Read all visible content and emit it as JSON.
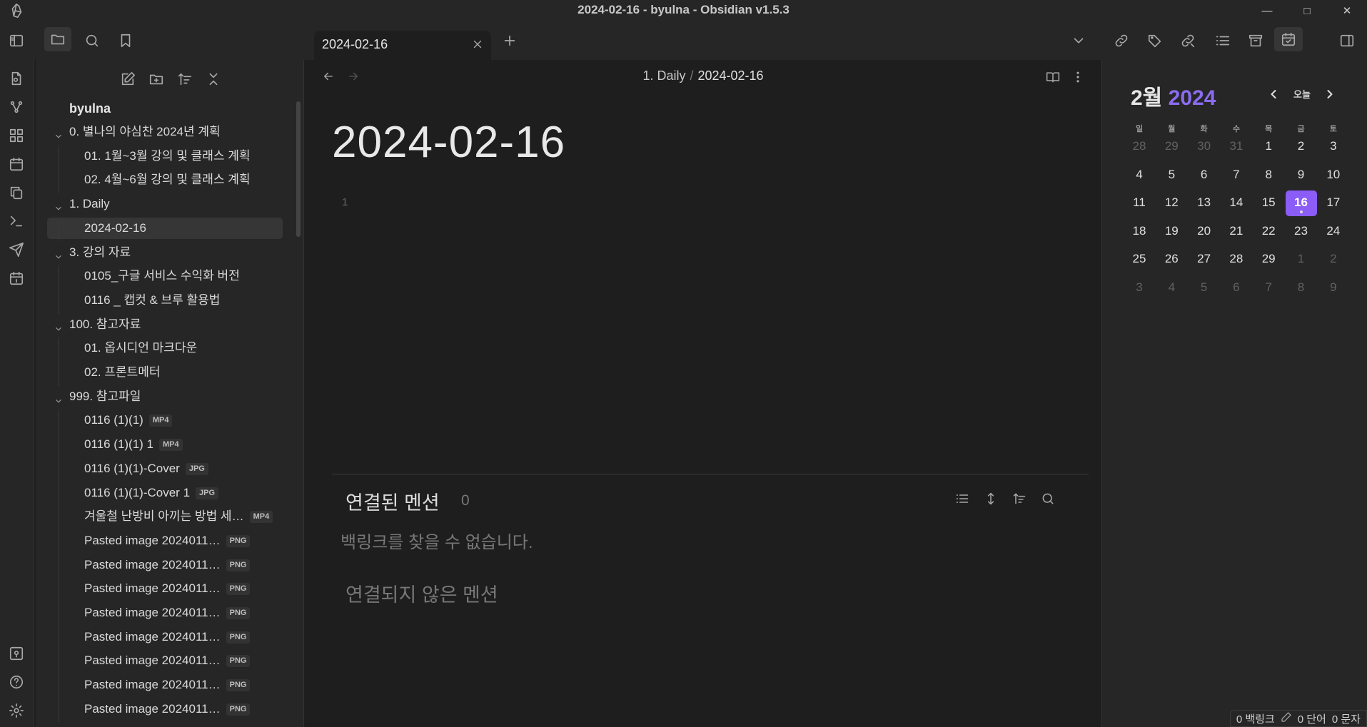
{
  "window": {
    "title": "2024-02-16 - byulna - Obsidian v1.5.3",
    "controls": [
      "minimize-icon",
      "maximize-icon",
      "close-icon"
    ]
  },
  "tab": {
    "title": "2024-02-16"
  },
  "sidebar": {
    "vault_name": "byulna",
    "tree": [
      {
        "label": "0. 별나의 야심찬 2024년 계획",
        "level": 0,
        "folder": true
      },
      {
        "label": "01. 1월~3월 강의 및 클래스 계획",
        "level": 1
      },
      {
        "label": "02. 4월~6월 강의 및 클래스 계획",
        "level": 1
      },
      {
        "label": "1. Daily",
        "level": 0,
        "folder": true
      },
      {
        "label": "2024-02-16",
        "level": 1,
        "active": true
      },
      {
        "label": "3. 강의 자료",
        "level": 0,
        "folder": true
      },
      {
        "label": "0105_구글 서비스 수익화 버전",
        "level": 1
      },
      {
        "label": "0116 _ 캡컷 & 브루 활용법",
        "level": 1
      },
      {
        "label": "100. 참고자료",
        "level": 0,
        "folder": true
      },
      {
        "label": "01. 옵시디언 마크다운",
        "level": 1
      },
      {
        "label": "02. 프론트메터",
        "level": 1
      },
      {
        "label": "999. 참고파일",
        "level": 0,
        "folder": true
      },
      {
        "label": "0116 (1)(1)",
        "level": 1,
        "badge": "MP4"
      },
      {
        "label": "0116 (1)(1) 1",
        "level": 1,
        "badge": "MP4"
      },
      {
        "label": "0116 (1)(1)-Cover",
        "level": 1,
        "badge": "JPG"
      },
      {
        "label": "0116 (1)(1)-Cover 1",
        "level": 1,
        "badge": "JPG"
      },
      {
        "label": "겨울철 난방비 아끼는 방법 세…",
        "level": 1,
        "badge": "MP4"
      },
      {
        "label": "Pasted image 2024011…",
        "level": 1,
        "badge": "PNG"
      },
      {
        "label": "Pasted image 2024011…",
        "level": 1,
        "badge": "PNG"
      },
      {
        "label": "Pasted image 2024011…",
        "level": 1,
        "badge": "PNG"
      },
      {
        "label": "Pasted image 2024011…",
        "level": 1,
        "badge": "PNG"
      },
      {
        "label": "Pasted image 2024011…",
        "level": 1,
        "badge": "PNG"
      },
      {
        "label": "Pasted image 2024011…",
        "level": 1,
        "badge": "PNG"
      },
      {
        "label": "Pasted image 2024011…",
        "level": 1,
        "badge": "PNG"
      },
      {
        "label": "Pasted image 2024011…",
        "level": 1,
        "badge": "PNG"
      }
    ]
  },
  "editor": {
    "breadcrumb_folder": "1. Daily",
    "breadcrumb_sep": "/",
    "breadcrumb_file": "2024-02-16",
    "title": "2024-02-16",
    "line_number": "1",
    "linked_mentions_label": "연결된 멘션",
    "linked_mentions_count": "0",
    "no_backlinks": "백링크를 찾을 수 없습니다.",
    "unlinked_mentions_label": "연결되지 않은 멘션"
  },
  "calendar": {
    "month": "2월",
    "year": "2024",
    "today_label": "오늘",
    "weekdays": [
      "월",
      "화",
      "수",
      "목",
      "금",
      "토",
      "일"
    ],
    "weekdays_display": [
      "일",
      "월",
      "화",
      "수",
      "목",
      "금",
      "토"
    ],
    "weeks": [
      [
        {
          "d": "28",
          "dim": true
        },
        {
          "d": "29",
          "dim": true
        },
        {
          "d": "30",
          "dim": true
        },
        {
          "d": "31",
          "dim": true
        },
        {
          "d": "1"
        },
        {
          "d": "2"
        },
        {
          "d": "3"
        }
      ],
      [
        {
          "d": "4"
        },
        {
          "d": "5"
        },
        {
          "d": "6"
        },
        {
          "d": "7"
        },
        {
          "d": "8"
        },
        {
          "d": "9"
        },
        {
          "d": "10"
        }
      ],
      [
        {
          "d": "11"
        },
        {
          "d": "12"
        },
        {
          "d": "13"
        },
        {
          "d": "14"
        },
        {
          "d": "15"
        },
        {
          "d": "16",
          "today": true
        },
        {
          "d": "17"
        }
      ],
      [
        {
          "d": "18"
        },
        {
          "d": "19"
        },
        {
          "d": "20"
        },
        {
          "d": "21"
        },
        {
          "d": "22"
        },
        {
          "d": "23"
        },
        {
          "d": "24"
        }
      ],
      [
        {
          "d": "25"
        },
        {
          "d": "26"
        },
        {
          "d": "27"
        },
        {
          "d": "28"
        },
        {
          "d": "29"
        },
        {
          "d": "1",
          "dim": true
        },
        {
          "d": "2",
          "dim": true
        }
      ],
      [
        {
          "d": "3",
          "dim": true
        },
        {
          "d": "4",
          "dim": true
        },
        {
          "d": "5",
          "dim": true
        },
        {
          "d": "6",
          "dim": true
        },
        {
          "d": "7",
          "dim": true
        },
        {
          "d": "8",
          "dim": true
        },
        {
          "d": "9",
          "dim": true
        }
      ]
    ]
  },
  "statusbar": {
    "backlinks": "0 백링크",
    "words": "0 단어",
    "chars": "0 문자"
  },
  "colors": {
    "accent": "#8b5cf6",
    "bg": "#1e1e1e",
    "panel": "#262626"
  }
}
